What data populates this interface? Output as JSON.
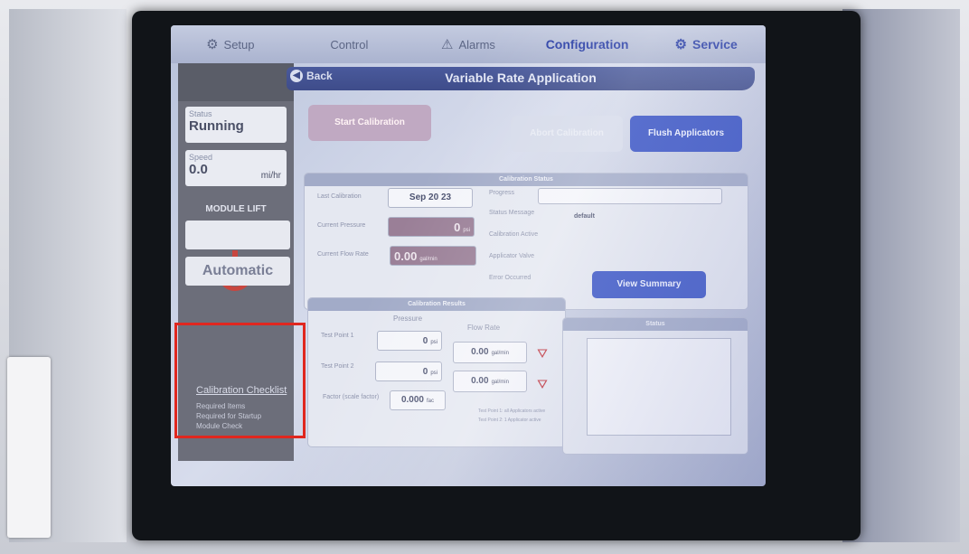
{
  "tabs": [
    {
      "label": "Setup",
      "icon": "gear-icon"
    },
    {
      "label": "Control",
      "icon": ""
    },
    {
      "label": "Alarms",
      "icon": "warning-icon"
    },
    {
      "label": "Configuration",
      "icon": ""
    },
    {
      "label": "Service",
      "icon": "gear-icon"
    }
  ],
  "sidebar": {
    "status_caption": "Status",
    "status_value": "Running",
    "speed_caption": "Speed",
    "speed_value": "0.0",
    "speed_unit": "mi/hr",
    "module_lift": "MODULE LIFT",
    "mode_button": "Automatic",
    "checklist_title": "Calibration Checklist",
    "checklist_items": [
      "Required Items",
      "Required for Startup",
      "Module Check"
    ]
  },
  "header": {
    "back_label": "Back",
    "title": "Variable Rate Application"
  },
  "actions": {
    "start": "Start Calibration",
    "abort": "Abort Calibration",
    "flush": "Flush Applicators"
  },
  "calibration_status": {
    "title": "Calibration Status",
    "last_calibration_label": "Last Calibration",
    "last_calibration_value": "Sep 20 23",
    "current_pressure_label": "Current Pressure",
    "current_pressure_value": "0",
    "current_pressure_unit": "psi",
    "current_flow_label": "Current Flow Rate",
    "current_flow_value": "0.00",
    "current_flow_unit": "gal/min",
    "progress_label": "Progress",
    "progress_fraction": 0,
    "status_message_label": "Status Message",
    "status_message_value": "default",
    "calibration_active_label": "Calibration Active",
    "applicator_valve_label": "Applicator Valve",
    "error_occurred_label": "Error Occurred",
    "view_summary": "View Summary"
  },
  "calibration_results": {
    "title": "Calibration Results",
    "col_pressure": "Pressure",
    "col_flow": "Flow Rate",
    "rows": [
      {
        "label": "Test Point 1",
        "pressure": "0",
        "pressure_unit": "psi",
        "flow": "0.00",
        "flow_unit": "gal/min"
      },
      {
        "label": "Test Point 2",
        "pressure": "0",
        "pressure_unit": "psi",
        "flow": "0.00",
        "flow_unit": "gal/min"
      }
    ],
    "factor_label": "Factor (scale factor)",
    "factor_value": "0.000",
    "factor_unit": "fac",
    "note_1": "Test Point 1: all Applicators active",
    "note_2": "Test Point 2: 1 Applicator active"
  },
  "status_chart": {
    "title": "Status"
  },
  "colors": {
    "accent": "#3a55c6",
    "highlight_box": "#e0271f",
    "warning": "#c03039"
  }
}
